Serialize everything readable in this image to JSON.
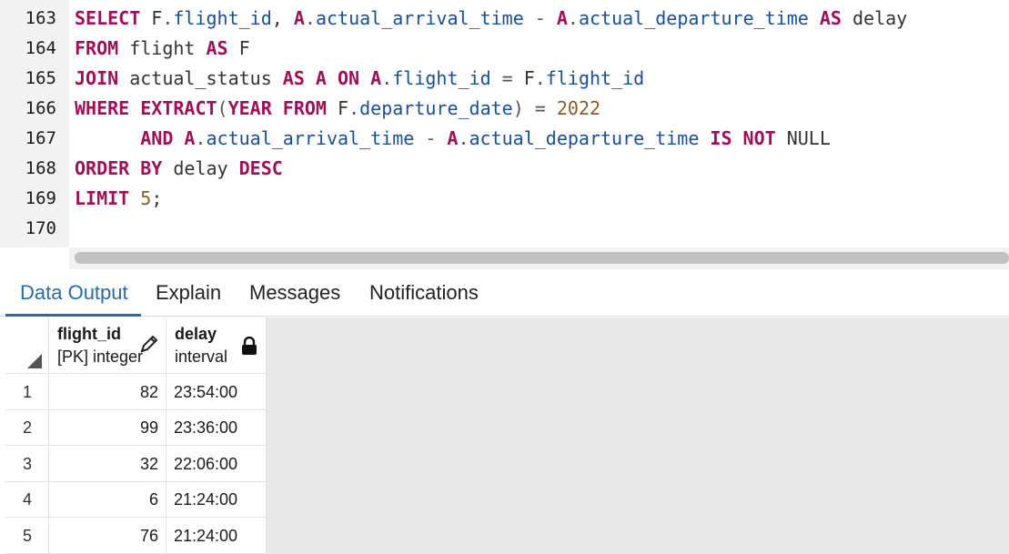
{
  "editor": {
    "line_numbers": [
      "163",
      "164",
      "165",
      "166",
      "167",
      "168",
      "169",
      "170"
    ],
    "lines": [
      [
        {
          "t": "SELECT",
          "c": "kw"
        },
        {
          "t": " F",
          "c": "plain"
        },
        {
          "t": ".",
          "c": "op"
        },
        {
          "t": "flight_id",
          "c": "id"
        },
        {
          "t": ", ",
          "c": "plain"
        },
        {
          "t": "A",
          "c": "kw"
        },
        {
          "t": ".",
          "c": "op"
        },
        {
          "t": "actual_arrival_time",
          "c": "id"
        },
        {
          "t": " - ",
          "c": "op"
        },
        {
          "t": "A",
          "c": "kw"
        },
        {
          "t": ".",
          "c": "op"
        },
        {
          "t": "actual_departure_time",
          "c": "id"
        },
        {
          "t": " AS",
          "c": "kw"
        },
        {
          "t": " delay",
          "c": "plain"
        }
      ],
      [
        {
          "t": "FROM",
          "c": "kw"
        },
        {
          "t": " flight ",
          "c": "plain"
        },
        {
          "t": "AS",
          "c": "kw"
        },
        {
          "t": " F",
          "c": "plain"
        }
      ],
      [
        {
          "t": "JOIN",
          "c": "kw"
        },
        {
          "t": " actual_status ",
          "c": "plain"
        },
        {
          "t": "AS",
          "c": "kw"
        },
        {
          "t": " A ",
          "c": "kw"
        },
        {
          "t": "ON",
          "c": "kw"
        },
        {
          "t": " A",
          "c": "kw"
        },
        {
          "t": ".",
          "c": "op"
        },
        {
          "t": "flight_id",
          "c": "id"
        },
        {
          "t": " = ",
          "c": "op"
        },
        {
          "t": "F",
          "c": "plain"
        },
        {
          "t": ".",
          "c": "op"
        },
        {
          "t": "flight_id",
          "c": "id"
        }
      ],
      [
        {
          "t": "WHERE",
          "c": "kw"
        },
        {
          "t": " EXTRACT",
          "c": "kw"
        },
        {
          "t": "(",
          "c": "op"
        },
        {
          "t": "YEAR",
          "c": "kw"
        },
        {
          "t": " FROM",
          "c": "kw"
        },
        {
          "t": " F",
          "c": "plain"
        },
        {
          "t": ".",
          "c": "op"
        },
        {
          "t": "departure_date",
          "c": "id"
        },
        {
          "t": ")",
          "c": "op"
        },
        {
          "t": " = ",
          "c": "op"
        },
        {
          "t": "2022",
          "c": "num"
        }
      ],
      [
        {
          "t": "      AND",
          "c": "kw"
        },
        {
          "t": " A",
          "c": "kw"
        },
        {
          "t": ".",
          "c": "op"
        },
        {
          "t": "actual_arrival_time",
          "c": "id"
        },
        {
          "t": " - ",
          "c": "op"
        },
        {
          "t": "A",
          "c": "kw"
        },
        {
          "t": ".",
          "c": "op"
        },
        {
          "t": "actual_departure_time",
          "c": "id"
        },
        {
          "t": " IS",
          "c": "kw"
        },
        {
          "t": " NOT",
          "c": "kw"
        },
        {
          "t": " NULL",
          "c": "plain"
        }
      ],
      [
        {
          "t": "ORDER",
          "c": "kw"
        },
        {
          "t": " BY",
          "c": "kw"
        },
        {
          "t": " delay ",
          "c": "plain"
        },
        {
          "t": "DESC",
          "c": "kw"
        }
      ],
      [
        {
          "t": "LIMIT",
          "c": "kw"
        },
        {
          "t": " 5",
          "c": "num"
        },
        {
          "t": ";",
          "c": "plain"
        }
      ],
      []
    ]
  },
  "tabs": [
    {
      "label": "Data Output",
      "active": true
    },
    {
      "label": "Explain",
      "active": false
    },
    {
      "label": "Messages",
      "active": false
    },
    {
      "label": "Notifications",
      "active": false
    }
  ],
  "grid": {
    "columns": [
      {
        "name": "flight_id",
        "type": "[PK] integer",
        "icon": "pencil-icon"
      },
      {
        "name": "delay",
        "type": "interval",
        "icon": "lock-icon"
      }
    ],
    "rows": [
      {
        "num": "1",
        "flight_id": "82",
        "delay": "23:54:00"
      },
      {
        "num": "2",
        "flight_id": "99",
        "delay": "23:36:00"
      },
      {
        "num": "3",
        "flight_id": "32",
        "delay": "22:06:00"
      },
      {
        "num": "4",
        "flight_id": "6",
        "delay": "21:24:00"
      },
      {
        "num": "5",
        "flight_id": "76",
        "delay": "21:24:00"
      }
    ]
  },
  "colors": {
    "accent": "#2a6aa8",
    "keyword": "#a0105a",
    "identifier": "#1a4f96",
    "number": "#8a5a2b"
  }
}
